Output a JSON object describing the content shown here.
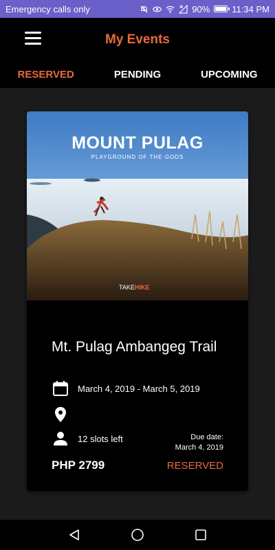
{
  "status_bar": {
    "carrier": "Emergency calls only",
    "battery": "90%",
    "time": "11:34 PM"
  },
  "app_bar": {
    "title": "My Events",
    "menu_icon": "hamburger-menu-icon"
  },
  "tabs": [
    {
      "label": "RESERVED",
      "active": true
    },
    {
      "label": "PENDING",
      "active": false
    },
    {
      "label": "UPCOMING",
      "active": false
    }
  ],
  "event": {
    "image_title": "MOUNT PULAG",
    "image_subtitle": "PLAYGROUND OF THE GODS",
    "image_logo_a": "TAKE",
    "image_logo_b": "HIKE",
    "name": "Mt. Pulag Ambangeg Trail",
    "dates": "March 4, 2019 - March 5, 2019",
    "location": "",
    "slots": "12 slots left",
    "due_label": "Due date:",
    "due_date": "March 4, 2019",
    "price": "PHP 2799",
    "status": "RESERVED"
  },
  "colors": {
    "accent": "#e86a3e",
    "status_bar": "#6b5fc9",
    "background": "#1b1b1b",
    "card": "#000000"
  },
  "nav": [
    "back-icon",
    "home-icon",
    "recents-icon"
  ]
}
